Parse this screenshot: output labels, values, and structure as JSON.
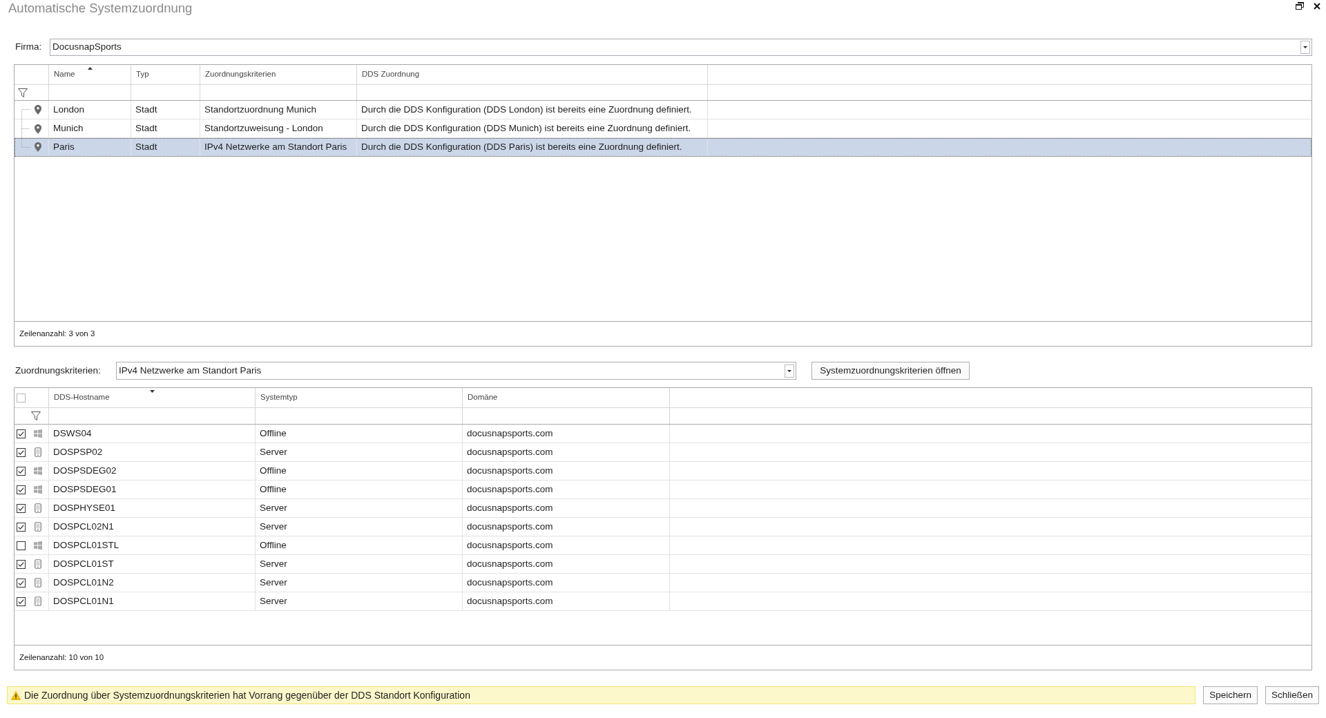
{
  "window": {
    "title": "Automatische Systemzuordnung"
  },
  "company": {
    "label": "Firma:",
    "value": "DocusnapSports"
  },
  "locations_table": {
    "columns": [
      {
        "label": "Name",
        "sort_ascending": true
      },
      {
        "label": "Typ"
      },
      {
        "label": "Zuordnungskriterien"
      },
      {
        "label": "DDS Zuordnung"
      }
    ],
    "rows": [
      {
        "name": "London",
        "type": "Stadt",
        "criteria": "Standortzuordnung Munich",
        "dds_assignment": "Durch die DDS Konfiguration (DDS London) ist bereits eine Zuordnung definiert.",
        "selected": false
      },
      {
        "name": "Munich",
        "type": "Stadt",
        "criteria": "Standortzuweisung - London",
        "dds_assignment": "Durch die DDS Konfiguration (DDS Munich) ist bereits eine Zuordnung definiert.",
        "selected": false
      },
      {
        "name": "Paris",
        "type": "Stadt",
        "criteria": "IPv4 Netzwerke am Standort Paris",
        "dds_assignment": "Durch die DDS Konfiguration (DDS Paris) ist bereits eine Zuordnung definiert.",
        "selected": true
      }
    ],
    "row_count": "Zeilenanzahl: 3 von 3"
  },
  "criteria": {
    "label": "Zuordnungskriterien:",
    "value": "IPv4 Netzwerke am Standort Paris",
    "open_button": "Systemzuordnungskriterien öffnen"
  },
  "systems_table": {
    "select_all": {
      "checked": false
    },
    "columns": [
      {
        "label": "DDS-Hostname",
        "sort_descending": true
      },
      {
        "label": "Systemtyp"
      },
      {
        "label": "Domäne"
      }
    ],
    "rows": [
      {
        "checked": true,
        "kind": "windows",
        "hostname": "DSWS04",
        "system_type": "Offline",
        "domain": "docusnapsports.com"
      },
      {
        "checked": true,
        "kind": "device",
        "hostname": "DOSPSP02",
        "system_type": "Server",
        "domain": "docusnapsports.com"
      },
      {
        "checked": true,
        "kind": "windows",
        "hostname": "DOSPSDEG02",
        "system_type": "Offline",
        "domain": "docusnapsports.com"
      },
      {
        "checked": true,
        "kind": "windows",
        "hostname": "DOSPSDEG01",
        "system_type": "Offline",
        "domain": "docusnapsports.com"
      },
      {
        "checked": true,
        "kind": "device",
        "hostname": "DOSPHYSE01",
        "system_type": "Server",
        "domain": "docusnapsports.com"
      },
      {
        "checked": true,
        "kind": "device",
        "hostname": "DOSPCL02N1",
        "system_type": "Server",
        "domain": "docusnapsports.com"
      },
      {
        "checked": false,
        "kind": "windows",
        "hostname": "DOSPCL01STL",
        "system_type": "Offline",
        "domain": "docusnapsports.com"
      },
      {
        "checked": true,
        "kind": "device",
        "hostname": "DOSPCL01ST",
        "system_type": "Server",
        "domain": "docusnapsports.com"
      },
      {
        "checked": true,
        "kind": "device",
        "hostname": "DOSPCL01N2",
        "system_type": "Server",
        "domain": "docusnapsports.com"
      },
      {
        "checked": true,
        "kind": "device",
        "hostname": "DOSPCL01N1",
        "system_type": "Server",
        "domain": "docusnapsports.com"
      }
    ],
    "row_count": "Zeilenanzahl: 10 von 10"
  },
  "notice": {
    "text": "Die Zuordnung über Systemzuordnungskriterien hat Vorrang gegenüber der DDS Standort Konfiguration"
  },
  "buttons": [
    {
      "label": "Speichern"
    },
    {
      "label": "Schließen"
    }
  ]
}
